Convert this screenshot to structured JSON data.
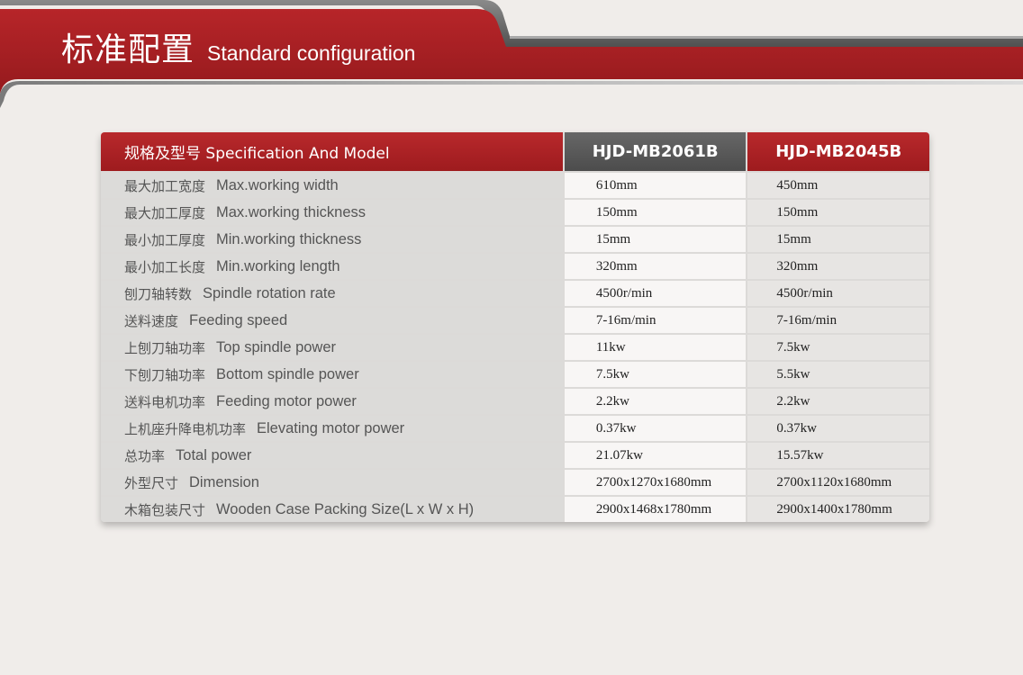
{
  "header": {
    "title_cn": "标准配置",
    "title_en": "Standard configuration"
  },
  "colors": {
    "brand_red": "#a61e22",
    "header_gray": "#5a5a5a",
    "background": "#f0edea"
  },
  "table": {
    "header": {
      "spec_label": "规格及型号 Specification And Model",
      "models": [
        "HJD-MB2061B",
        "HJD-MB2045B"
      ]
    },
    "rows": [
      {
        "cn": "最大加工宽度",
        "en": "Max.working width",
        "v1": "610mm",
        "v2": "450mm"
      },
      {
        "cn": "最大加工厚度",
        "en": "Max.working thickness",
        "v1": "150mm",
        "v2": "150mm"
      },
      {
        "cn": "最小加工厚度",
        "en": "Min.working thickness",
        "v1": "15mm",
        "v2": "15mm"
      },
      {
        "cn": "最小加工长度",
        "en": "Min.working length",
        "v1": "320mm",
        "v2": "320mm"
      },
      {
        "cn": "刨刀轴转数",
        "en": "Spindle rotation rate",
        "v1": "4500r/min",
        "v2": "4500r/min"
      },
      {
        "cn": "送料速度",
        "en": "Feeding speed",
        "v1": "7-16m/min",
        "v2": "7-16m/min"
      },
      {
        "cn": "上刨刀轴功率",
        "en": "Top spindle power",
        "v1": "11kw",
        "v2": "7.5kw"
      },
      {
        "cn": "下刨刀轴功率",
        "en": "Bottom spindle power",
        "v1": "7.5kw",
        "v2": "5.5kw"
      },
      {
        "cn": "送料电机功率",
        "en": "Feeding motor power",
        "v1": "2.2kw",
        "v2": "2.2kw"
      },
      {
        "cn": "上机座升降电机功率",
        "en": "Elevating motor power",
        "v1": "0.37kw",
        "v2": "0.37kw"
      },
      {
        "cn": "总功率",
        "en": "Total power",
        "v1": "21.07kw",
        "v2": "15.57kw"
      },
      {
        "cn": "外型尺寸",
        "en": "Dimension",
        "v1": "2700x1270x1680mm",
        "v2": "2700x1120x1680mm"
      },
      {
        "cn": "木箱包装尺寸",
        "en": "Wooden Case Packing Size(L x W x H)",
        "v1": "2900x1468x1780mm",
        "v2": "2900x1400x1780mm"
      }
    ]
  }
}
